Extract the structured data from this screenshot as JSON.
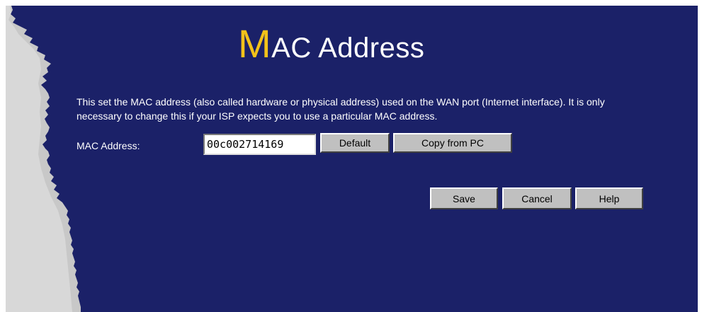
{
  "page": {
    "title_first_letter": "M",
    "title_rest": "AC Address",
    "description": "This set the MAC address (also called hardware or physical address) used on the WAN port (Internet interface). It is only necessary to change this if your ISP expects you to use a particular MAC address."
  },
  "form": {
    "mac_label": "MAC Address:",
    "mac_value": "00c002714169",
    "default_label": "Default",
    "copy_label": "Copy from PC"
  },
  "actions": {
    "save_label": "Save",
    "cancel_label": "Cancel",
    "help_label": "Help"
  },
  "colors": {
    "background": "#1b2168",
    "title_accent": "#f2c21a",
    "edge": "#c8c8c8"
  }
}
